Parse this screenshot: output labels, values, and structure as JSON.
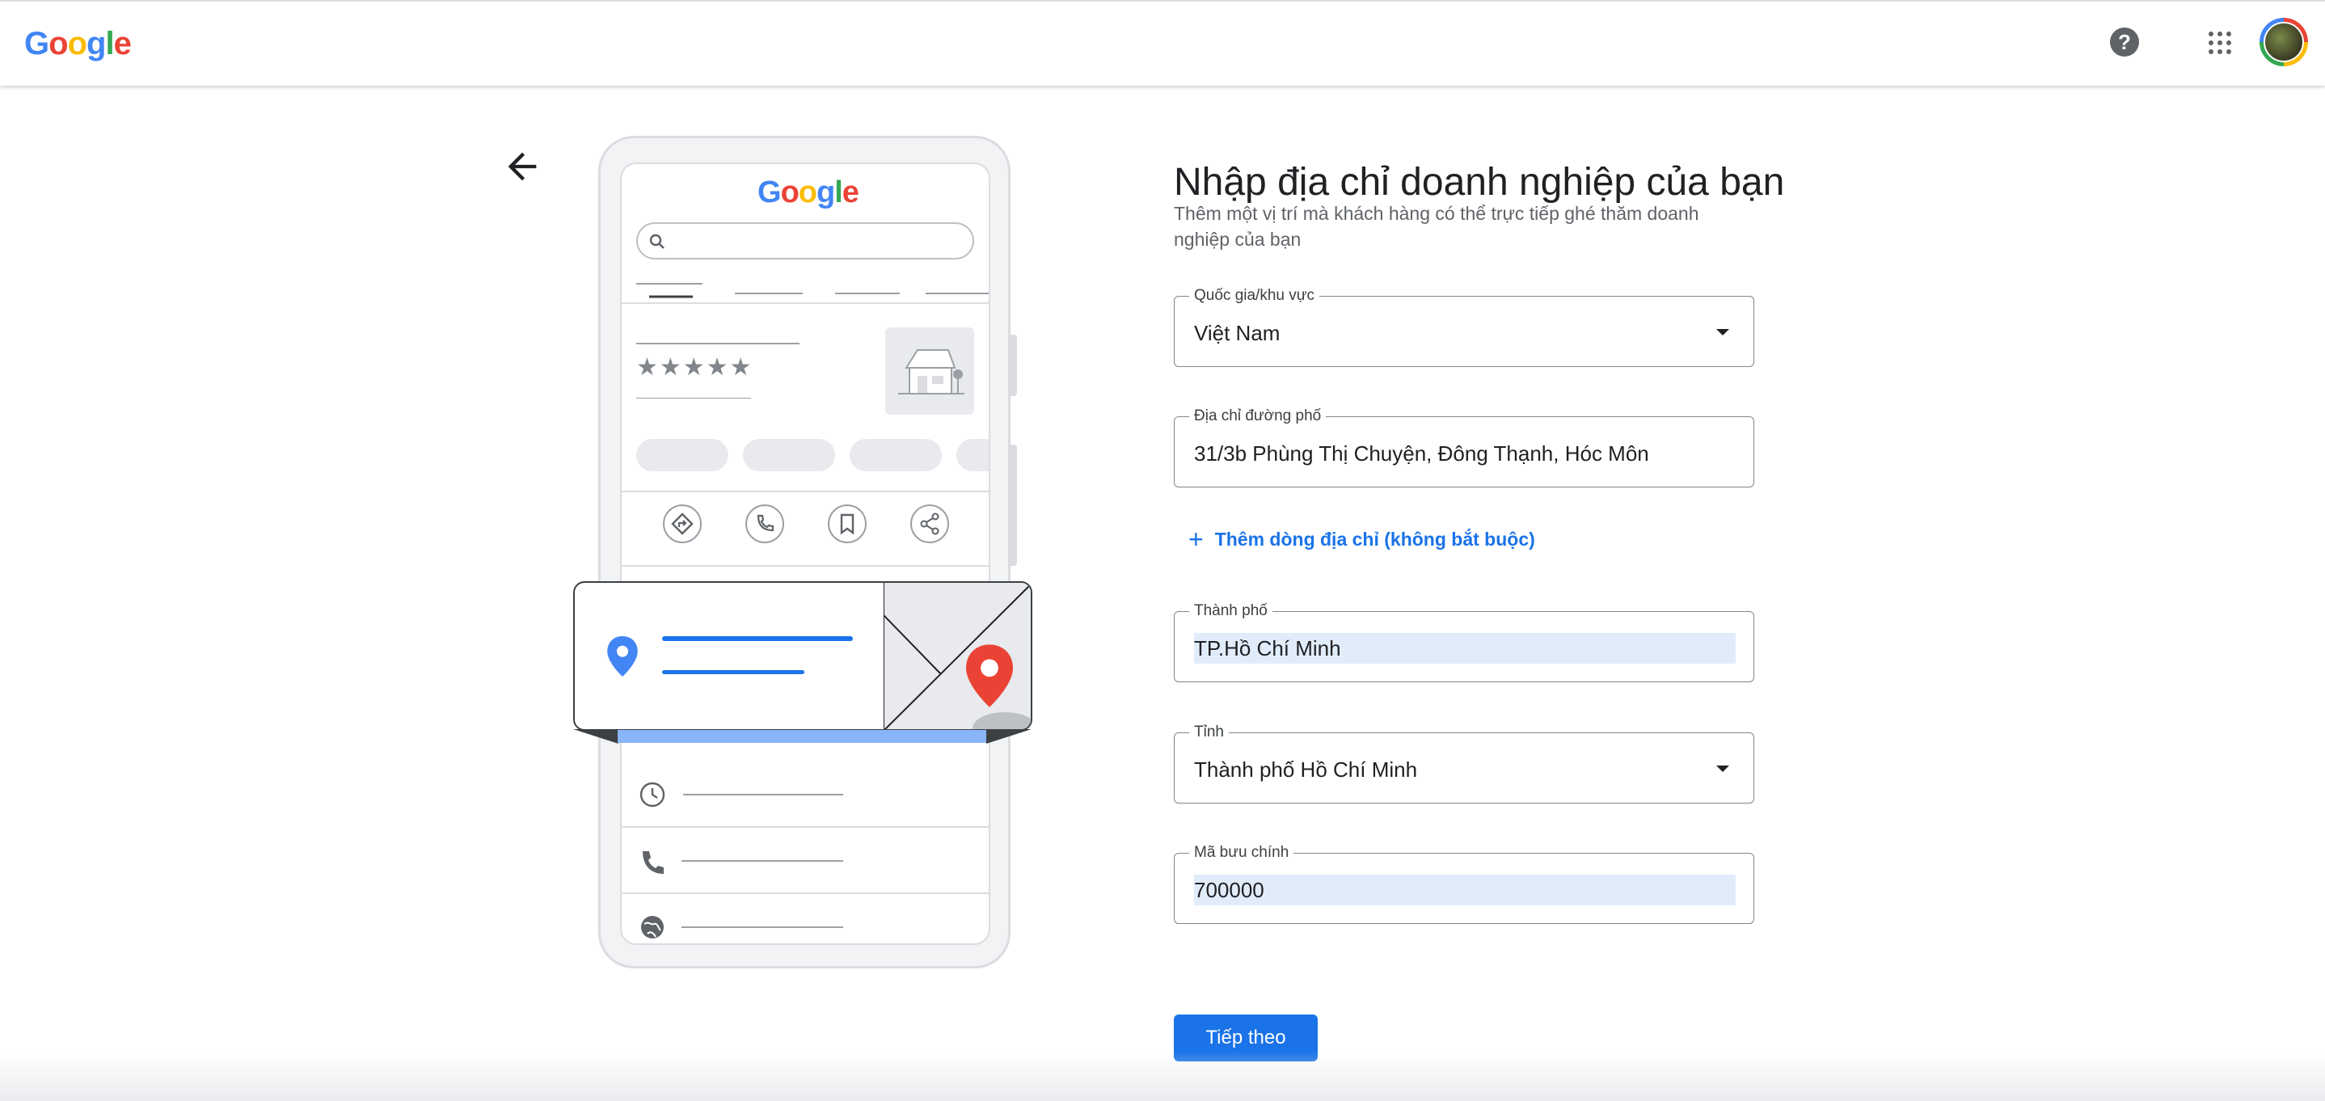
{
  "header": {
    "logo_text": "Google",
    "help_icon": "help-circle-icon",
    "apps_icon": "apps-grid-icon",
    "avatar_icon": "account-avatar"
  },
  "nav": {
    "back_icon": "arrow-back-icon"
  },
  "illustration": {
    "logo_text": "Google",
    "rating_stars": "★★★★★",
    "action_icons": [
      "directions-icon",
      "phone-icon",
      "bookmark-icon",
      "share-icon"
    ],
    "info_icons": [
      "clock-icon",
      "phone-icon",
      "globe-icon"
    ]
  },
  "form": {
    "title": "Nhập địa chỉ doanh nghiệp của bạn",
    "subtitle": "Thêm một vị trí mà khách hàng có thể trực tiếp ghé thăm doanh nghiệp của bạn",
    "country": {
      "label": "Quốc gia/khu vực",
      "value": "Việt Nam"
    },
    "street": {
      "label": "Địa chỉ đường phố",
      "value": "31/3b Phùng Thị Chuyện, Đông Thạnh, Hóc Môn"
    },
    "add_line": {
      "icon": "+",
      "label": "Thêm dòng địa chỉ (không bắt buộc)"
    },
    "city": {
      "label": "Thành phố",
      "value": "TP.Hồ Chí Minh"
    },
    "province": {
      "label": "Tỉnh",
      "value": "Thành phố Hồ Chí Minh"
    },
    "postal": {
      "label": "Mã bưu chính",
      "value": "700000"
    },
    "next_label": "Tiếp theo"
  },
  "colors": {
    "primary": "#1a73e8",
    "highlight": "#e1ecfb",
    "pin_red": "#ea4335",
    "pin_blue": "#4285f4"
  }
}
